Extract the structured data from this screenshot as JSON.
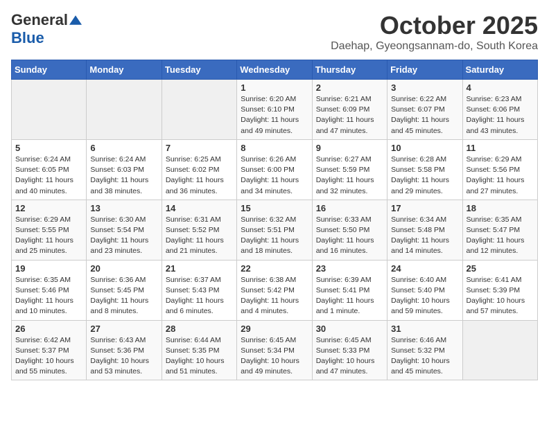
{
  "header": {
    "logo": {
      "general": "General",
      "blue": "Blue",
      "tagline": ""
    },
    "title": "October 2025",
    "subtitle": "Daehap, Gyeongsannam-do, South Korea"
  },
  "weekdays": [
    "Sunday",
    "Monday",
    "Tuesday",
    "Wednesday",
    "Thursday",
    "Friday",
    "Saturday"
  ],
  "weeks": [
    [
      {
        "day": "",
        "info": ""
      },
      {
        "day": "",
        "info": ""
      },
      {
        "day": "",
        "info": ""
      },
      {
        "day": "1",
        "info": "Sunrise: 6:20 AM\nSunset: 6:10 PM\nDaylight: 11 hours\nand 49 minutes."
      },
      {
        "day": "2",
        "info": "Sunrise: 6:21 AM\nSunset: 6:09 PM\nDaylight: 11 hours\nand 47 minutes."
      },
      {
        "day": "3",
        "info": "Sunrise: 6:22 AM\nSunset: 6:07 PM\nDaylight: 11 hours\nand 45 minutes."
      },
      {
        "day": "4",
        "info": "Sunrise: 6:23 AM\nSunset: 6:06 PM\nDaylight: 11 hours\nand 43 minutes."
      }
    ],
    [
      {
        "day": "5",
        "info": "Sunrise: 6:24 AM\nSunset: 6:05 PM\nDaylight: 11 hours\nand 40 minutes."
      },
      {
        "day": "6",
        "info": "Sunrise: 6:24 AM\nSunset: 6:03 PM\nDaylight: 11 hours\nand 38 minutes."
      },
      {
        "day": "7",
        "info": "Sunrise: 6:25 AM\nSunset: 6:02 PM\nDaylight: 11 hours\nand 36 minutes."
      },
      {
        "day": "8",
        "info": "Sunrise: 6:26 AM\nSunset: 6:00 PM\nDaylight: 11 hours\nand 34 minutes."
      },
      {
        "day": "9",
        "info": "Sunrise: 6:27 AM\nSunset: 5:59 PM\nDaylight: 11 hours\nand 32 minutes."
      },
      {
        "day": "10",
        "info": "Sunrise: 6:28 AM\nSunset: 5:58 PM\nDaylight: 11 hours\nand 29 minutes."
      },
      {
        "day": "11",
        "info": "Sunrise: 6:29 AM\nSunset: 5:56 PM\nDaylight: 11 hours\nand 27 minutes."
      }
    ],
    [
      {
        "day": "12",
        "info": "Sunrise: 6:29 AM\nSunset: 5:55 PM\nDaylight: 11 hours\nand 25 minutes."
      },
      {
        "day": "13",
        "info": "Sunrise: 6:30 AM\nSunset: 5:54 PM\nDaylight: 11 hours\nand 23 minutes."
      },
      {
        "day": "14",
        "info": "Sunrise: 6:31 AM\nSunset: 5:52 PM\nDaylight: 11 hours\nand 21 minutes."
      },
      {
        "day": "15",
        "info": "Sunrise: 6:32 AM\nSunset: 5:51 PM\nDaylight: 11 hours\nand 18 minutes."
      },
      {
        "day": "16",
        "info": "Sunrise: 6:33 AM\nSunset: 5:50 PM\nDaylight: 11 hours\nand 16 minutes."
      },
      {
        "day": "17",
        "info": "Sunrise: 6:34 AM\nSunset: 5:48 PM\nDaylight: 11 hours\nand 14 minutes."
      },
      {
        "day": "18",
        "info": "Sunrise: 6:35 AM\nSunset: 5:47 PM\nDaylight: 11 hours\nand 12 minutes."
      }
    ],
    [
      {
        "day": "19",
        "info": "Sunrise: 6:35 AM\nSunset: 5:46 PM\nDaylight: 11 hours\nand 10 minutes."
      },
      {
        "day": "20",
        "info": "Sunrise: 6:36 AM\nSunset: 5:45 PM\nDaylight: 11 hours\nand 8 minutes."
      },
      {
        "day": "21",
        "info": "Sunrise: 6:37 AM\nSunset: 5:43 PM\nDaylight: 11 hours\nand 6 minutes."
      },
      {
        "day": "22",
        "info": "Sunrise: 6:38 AM\nSunset: 5:42 PM\nDaylight: 11 hours\nand 4 minutes."
      },
      {
        "day": "23",
        "info": "Sunrise: 6:39 AM\nSunset: 5:41 PM\nDaylight: 11 hours\nand 1 minute."
      },
      {
        "day": "24",
        "info": "Sunrise: 6:40 AM\nSunset: 5:40 PM\nDaylight: 10 hours\nand 59 minutes."
      },
      {
        "day": "25",
        "info": "Sunrise: 6:41 AM\nSunset: 5:39 PM\nDaylight: 10 hours\nand 57 minutes."
      }
    ],
    [
      {
        "day": "26",
        "info": "Sunrise: 6:42 AM\nSunset: 5:37 PM\nDaylight: 10 hours\nand 55 minutes."
      },
      {
        "day": "27",
        "info": "Sunrise: 6:43 AM\nSunset: 5:36 PM\nDaylight: 10 hours\nand 53 minutes."
      },
      {
        "day": "28",
        "info": "Sunrise: 6:44 AM\nSunset: 5:35 PM\nDaylight: 10 hours\nand 51 minutes."
      },
      {
        "day": "29",
        "info": "Sunrise: 6:45 AM\nSunset: 5:34 PM\nDaylight: 10 hours\nand 49 minutes."
      },
      {
        "day": "30",
        "info": "Sunrise: 6:45 AM\nSunset: 5:33 PM\nDaylight: 10 hours\nand 47 minutes."
      },
      {
        "day": "31",
        "info": "Sunrise: 6:46 AM\nSunset: 5:32 PM\nDaylight: 10 hours\nand 45 minutes."
      },
      {
        "day": "",
        "info": ""
      }
    ]
  ]
}
